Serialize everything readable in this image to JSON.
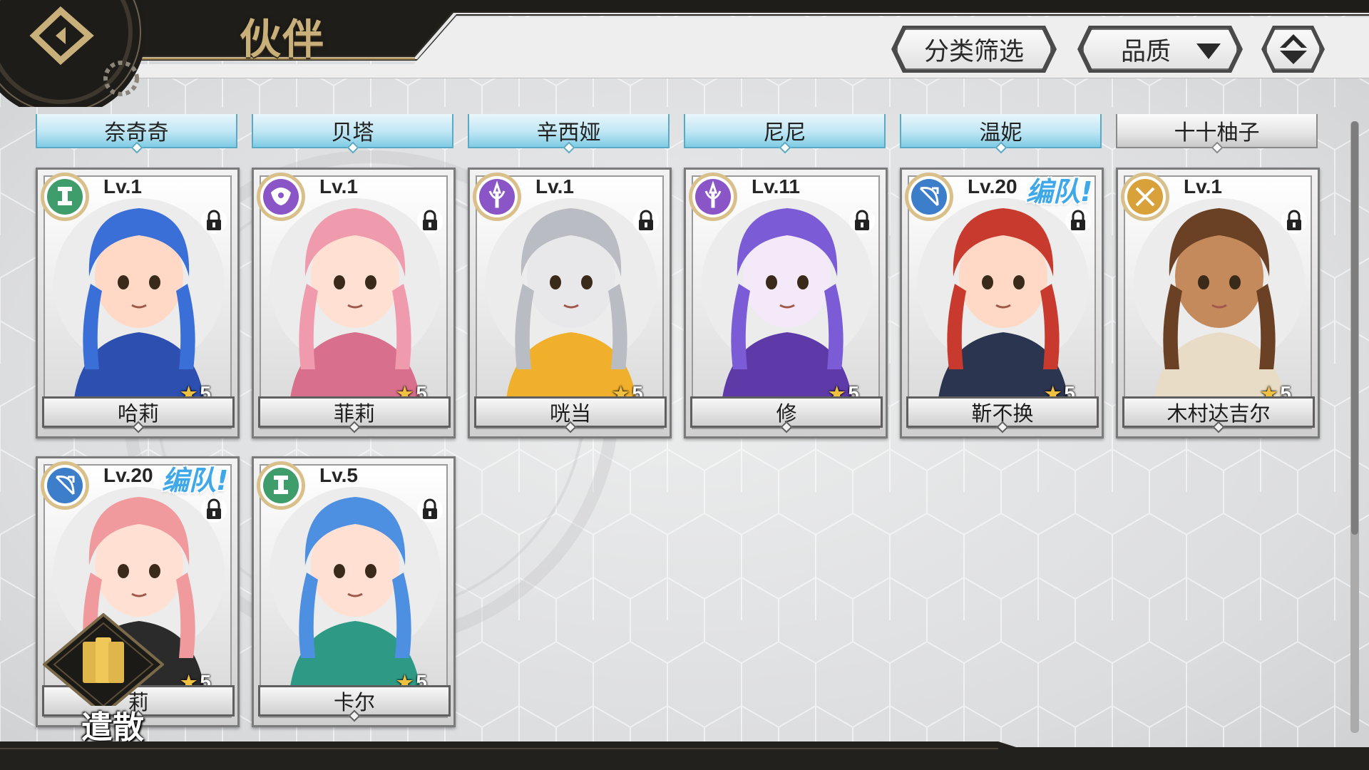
{
  "header": {
    "title": "伙伴",
    "filter_label": "分类筛选",
    "quality_label": "品质"
  },
  "colors": {
    "tab_blue": "#7fcce4",
    "team_tag": "#3ea8e8",
    "gold": "#c9b07a",
    "class_green": "#3f9c6b",
    "class_purple": "#8a55c7",
    "class_blue": "#3c7ec9",
    "class_orange": "#d8a13a"
  },
  "top_name_tabs": [
    {
      "name": "奈奇奇",
      "style": "blue"
    },
    {
      "name": "贝塔",
      "style": "blue"
    },
    {
      "name": "辛西娅",
      "style": "blue"
    },
    {
      "name": "尼尼",
      "style": "blue"
    },
    {
      "name": "温妮",
      "style": "blue"
    },
    {
      "name": "十十柚子",
      "style": "grey"
    }
  ],
  "cards": [
    {
      "name": "哈莉",
      "level": "Lv.1",
      "stars": "5",
      "class_icon": "tower-icon",
      "class_color": "green",
      "in_team": false,
      "team_tag": "",
      "locked": true
    },
    {
      "name": "菲莉",
      "level": "Lv.1",
      "stars": "5",
      "class_icon": "mask-icon",
      "class_color": "purple",
      "in_team": false,
      "team_tag": "",
      "locked": true
    },
    {
      "name": "咣当",
      "level": "Lv.1",
      "stars": "5",
      "class_icon": "trident-icon",
      "class_color": "purple",
      "in_team": false,
      "team_tag": "",
      "locked": true
    },
    {
      "name": "修",
      "level": "Lv.11",
      "stars": "5",
      "class_icon": "trident-icon",
      "class_color": "purple",
      "in_team": false,
      "team_tag": "",
      "locked": true
    },
    {
      "name": "靳不换",
      "level": "Lv.20",
      "stars": "5",
      "class_icon": "bow-icon",
      "class_color": "blue",
      "in_team": true,
      "team_tag": "编队!",
      "locked": true
    },
    {
      "name": "木村达吉尔",
      "level": "Lv.1",
      "stars": "5",
      "class_icon": "swords-icon",
      "class_color": "orange",
      "in_team": false,
      "team_tag": "",
      "locked": true
    },
    {
      "name": "莉",
      "level": "Lv.20",
      "stars": "5",
      "class_icon": "bow-icon",
      "class_color": "blue",
      "in_team": true,
      "team_tag": "编队!",
      "locked": true
    },
    {
      "name": "卡尔",
      "level": "Lv.5",
      "stars": "5",
      "class_icon": "tower-icon",
      "class_color": "green",
      "in_team": false,
      "team_tag": "",
      "locked": true
    }
  ],
  "dismiss": {
    "label": "遣散",
    "icon": "cards-icon"
  }
}
